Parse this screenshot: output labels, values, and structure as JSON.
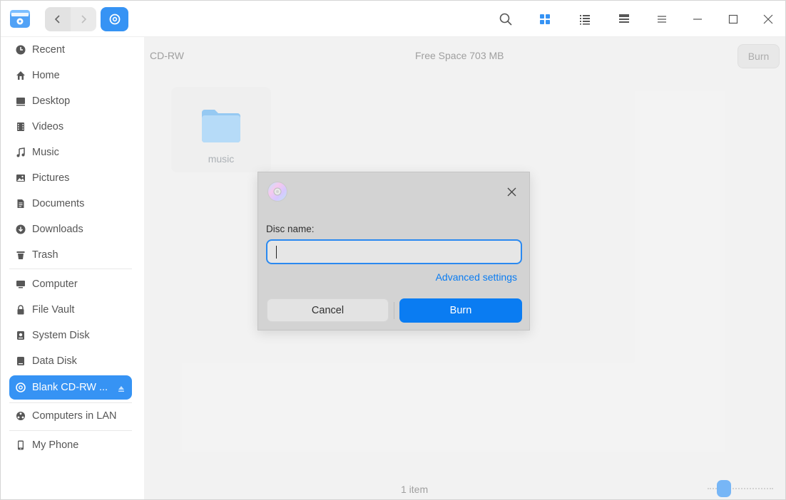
{
  "sidebar": {
    "items": [
      {
        "label": "Recent",
        "icon": "clock-icon"
      },
      {
        "label": "Home",
        "icon": "home-icon"
      },
      {
        "label": "Desktop",
        "icon": "desktop-icon"
      },
      {
        "label": "Videos",
        "icon": "video-icon"
      },
      {
        "label": "Music",
        "icon": "music-icon"
      },
      {
        "label": "Pictures",
        "icon": "picture-icon"
      },
      {
        "label": "Documents",
        "icon": "document-icon"
      },
      {
        "label": "Downloads",
        "icon": "download-icon"
      },
      {
        "label": "Trash",
        "icon": "trash-icon"
      }
    ],
    "devices": [
      {
        "label": "Computer",
        "icon": "computer-icon"
      },
      {
        "label": "File Vault",
        "icon": "lock-icon"
      },
      {
        "label": "System Disk",
        "icon": "disk-icon"
      },
      {
        "label": "Data Disk",
        "icon": "disk-icon"
      },
      {
        "label": "Blank CD-RW ...",
        "icon": "disc-icon",
        "active": true
      }
    ],
    "network": [
      {
        "label": "Computers in LAN",
        "icon": "network-icon"
      }
    ],
    "phone": [
      {
        "label": "My Phone",
        "icon": "phone-icon"
      }
    ]
  },
  "main": {
    "disc_label": "CD-RW",
    "free_space": "Free Space 703 MB",
    "burn_label": "Burn",
    "files": [
      {
        "name": "music",
        "icon": "folder-icon"
      }
    ],
    "status_count": "1 item"
  },
  "dialog": {
    "disc_name_label": "Disc name:",
    "disc_name_value": "",
    "advanced_label": "Advanced settings",
    "cancel_label": "Cancel",
    "burn_label": "Burn"
  },
  "colors": {
    "accent": "#0a7cf2",
    "folder": "#8cc8f5"
  }
}
